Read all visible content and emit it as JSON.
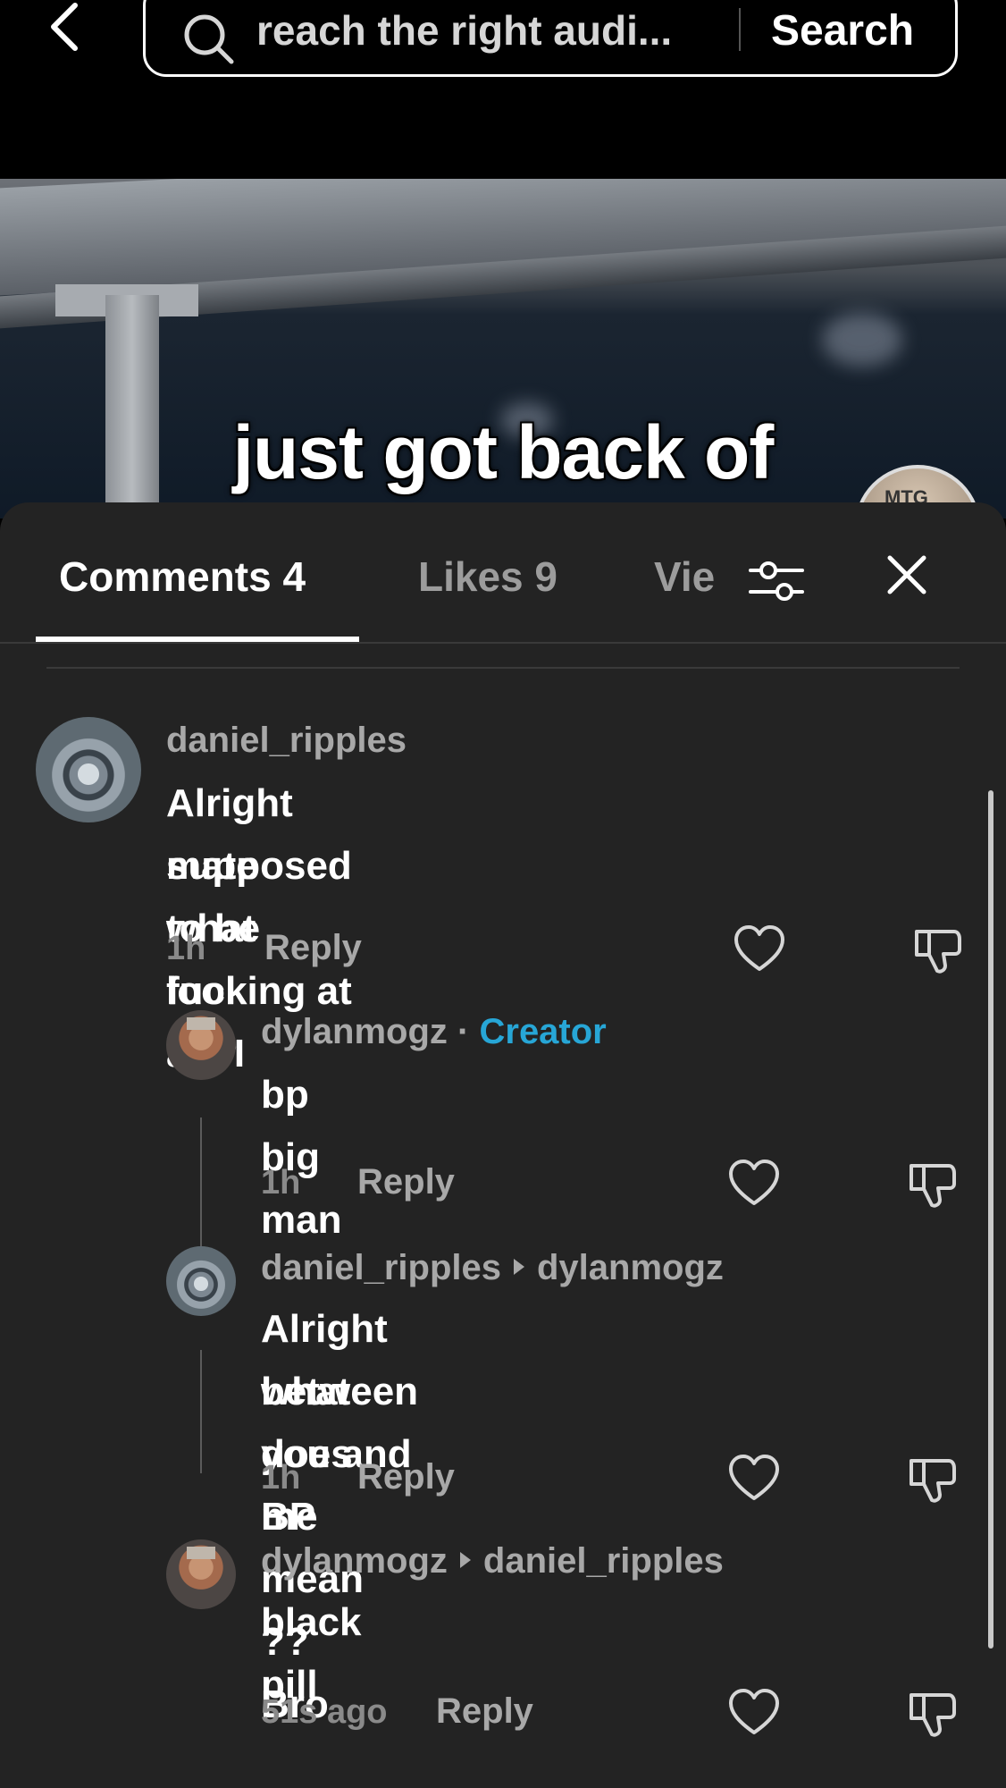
{
  "search": {
    "query": "reach the right audi...",
    "button_label": "Search"
  },
  "video": {
    "caption": "just got back of",
    "avatar_text": "MTG"
  },
  "tabs": {
    "comments_label": "Comments 4",
    "likes_label": "Likes 9",
    "views_label": "Vie"
  },
  "comments": [
    {
      "username": "daniel_ripples",
      "text_line1": "Alright mate what fuck am I",
      "text_line2": "supposed to be looking at ???",
      "time": "1h",
      "reply_label": "Reply"
    },
    {
      "username": "dylanmogz",
      "separator": "·",
      "badge": "Creator",
      "text_line1": "bp big man",
      "time": "1h",
      "reply_label": "Reply"
    },
    {
      "username": "daniel_ripples",
      "reply_to": "dylanmogz",
      "text_line1": "Alright between you and me",
      "text_line2": "what does BP mean ?? Bro",
      "time": "1h",
      "reply_label": "Reply"
    },
    {
      "username": "dylanmogz",
      "reply_to": "daniel_ripples",
      "text_line1": "black pill",
      "time": "51s ago",
      "reply_label": "Reply"
    }
  ],
  "colors": {
    "panel_bg": "#232323",
    "creator_badge": "#27a6d6",
    "muted_text": "#a8a8a8"
  }
}
